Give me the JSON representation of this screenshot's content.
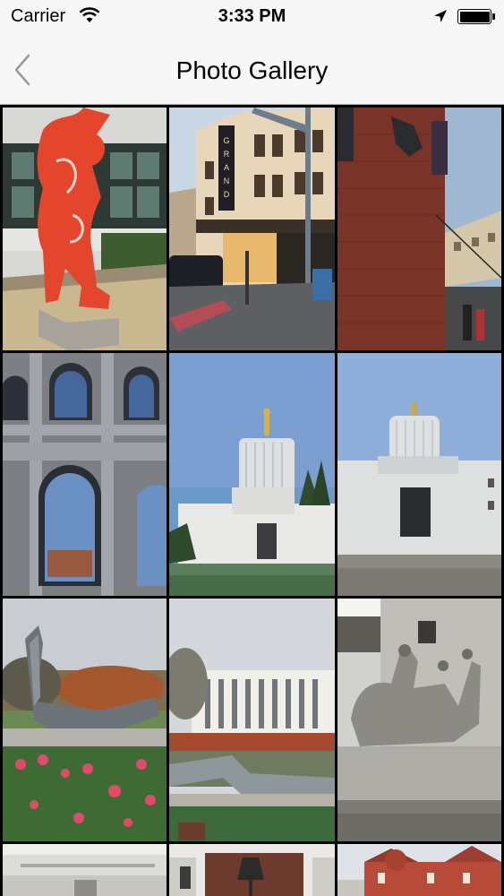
{
  "status_bar": {
    "carrier": "Carrier",
    "time": "3:33 PM",
    "icons": [
      "wifi-icon",
      "location-arrow-icon",
      "battery-icon"
    ]
  },
  "nav_bar": {
    "title": "Photo Gallery",
    "back_icon": "chevron-left-icon"
  },
  "gallery": {
    "photos": [
      {
        "subject": "red abstract sculpture"
      },
      {
        "subject": "Grand theater street"
      },
      {
        "subject": "brick building corner"
      },
      {
        "subject": "ornate building facade"
      },
      {
        "subject": "capitol building"
      },
      {
        "subject": "capitol building front"
      },
      {
        "subject": "curved metal sculpture with roses"
      },
      {
        "subject": "modern office building and plaza"
      },
      {
        "subject": "stone relief sculpture"
      },
      {
        "subject": "white stone building"
      },
      {
        "subject": "building with lamp"
      },
      {
        "subject": "red victorian building"
      }
    ]
  }
}
